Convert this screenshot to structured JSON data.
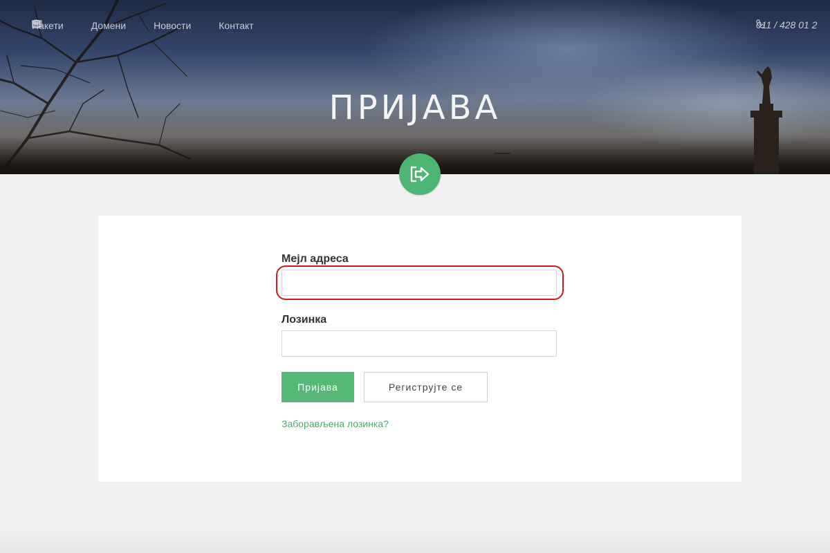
{
  "nav": {
    "items": [
      {
        "label": "Пакети",
        "icon": "archive-icon"
      },
      {
        "label": "Домени",
        "icon": "globe-icon"
      },
      {
        "label": "Новости",
        "icon": "newspaper-icon"
      },
      {
        "label": "Контакт",
        "icon": "envelope-icon"
      }
    ],
    "phone": "011 / 428 01 2"
  },
  "hero": {
    "title": "ПРИЈАВА",
    "icon": "sign-in-icon"
  },
  "form": {
    "email_label": "Мејл адреса",
    "email_value": "",
    "password_label": "Лозинка",
    "password_value": "",
    "login_button": "Пријава",
    "register_button": "Региструјте се",
    "forgot_link": "Заборављена лозинка?"
  },
  "colors": {
    "accent": "#55b877",
    "highlight": "#d6161b",
    "link": "#4aad6c",
    "page_bg": "#f1f1f1"
  }
}
